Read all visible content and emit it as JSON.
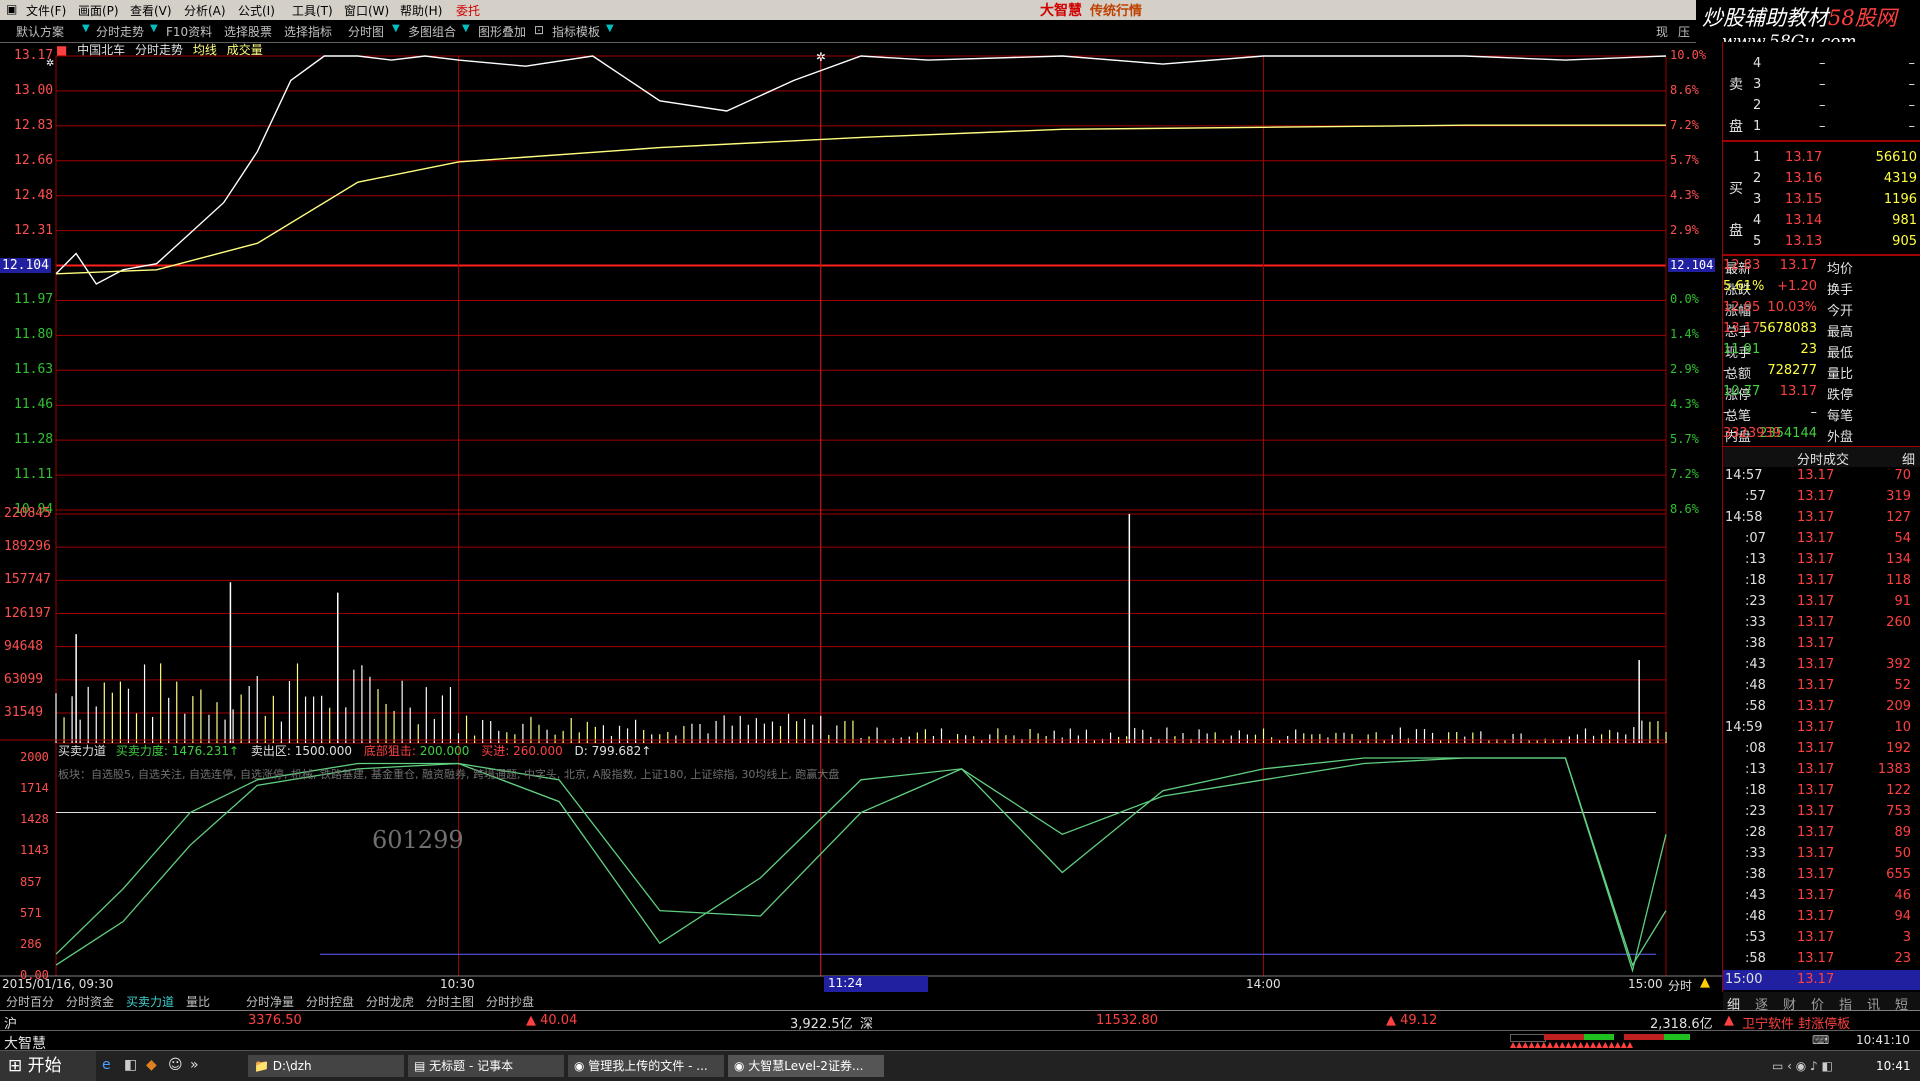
{
  "menu": {
    "items": [
      "文件(F)",
      "画面(P)",
      "查看(V)",
      "分析(A)",
      "公式(I)",
      "工具(T)",
      "窗口(W)",
      "帮助(H)",
      "委托"
    ],
    "brand": "大智慧",
    "brand_sub": "传统行情"
  },
  "watermark": {
    "line1_a": "炒股辅助教材",
    "line1_b": "58股网",
    "line2": "www.58Gu.com"
  },
  "toolbar": {
    "items": [
      "默认方案",
      "分时走势",
      "F10资料",
      "选择股票",
      "选择指标",
      "分时图",
      "多图组合",
      "图形叠加",
      "指标模板"
    ],
    "right": [
      "现",
      "压"
    ]
  },
  "legend": {
    "stock": "中国北车",
    "items": [
      "分时走势",
      "均线",
      "成交量"
    ]
  },
  "price_axis": {
    "labels": [
      "13.17",
      "13.00",
      "12.83",
      "12.66",
      "12.48",
      "12.31",
      "12.104",
      "11.97",
      "11.80",
      "11.63",
      "11.46",
      "11.28",
      "11.11",
      "10.94"
    ],
    "pct_labels": [
      "10.0%",
      "8.6%",
      "7.2%",
      "5.7%",
      "4.3%",
      "2.9%",
      "12.104",
      "0.0%",
      "1.4%",
      "2.9%",
      "4.3%",
      "5.7%",
      "7.2%",
      "8.6%"
    ]
  },
  "volume_axis": {
    "labels": [
      "220845",
      "189296",
      "157747",
      "126197",
      "94648",
      "63099",
      "31549"
    ]
  },
  "indicator": {
    "title": "买卖力道",
    "params": [
      {
        "k": "买卖力度",
        "v": "1476.231↑"
      },
      {
        "k": "卖出区",
        "v": "1500.000"
      },
      {
        "k": "底部狙击",
        "v": "200.000"
      },
      {
        "k": "买进",
        "v": "260.000"
      },
      {
        "k": "D",
        "v": "799.682↑"
      }
    ],
    "board_text": "板块：自选股5, 自选关注, 自选连停, 自选涨停, 机械, 铁路基建, 基金重仓, 融资融券, 跨境通题, 中字头, 北京, A股指数, 上证180, 上证综指, 30均线上, 跑赢大盘",
    "code_watermark": "601299",
    "labels": [
      "2000",
      "1714",
      "1428",
      "1143",
      "857",
      "571",
      "286",
      "0.00"
    ]
  },
  "time_axis": {
    "date_label": "2015/01/16, 09:30",
    "ticks": [
      "10:30",
      "11:24",
      "14:00",
      "15:00"
    ],
    "right": "分时"
  },
  "bottom_tabs": [
    "分时百分",
    "分时资金",
    "买卖力道",
    "量比",
    "分时净量",
    "分时控盘",
    "分时龙虎",
    "分时主图",
    "分时抄盘"
  ],
  "active_tab": "买卖力道",
  "index_bar": {
    "sh_label": "沪",
    "sh_value": "3376.50",
    "sh_change": "▲ 40.04",
    "sh_amount": "3,922.5亿",
    "sz_label": "深",
    "sz_value": "11532.80",
    "sz_change": "▲ 49.12",
    "sz_amount": "2,318.6亿",
    "notice": "卫宁软件 封涨停板"
  },
  "status": {
    "app": "大智慧",
    "time": "10:41:10"
  },
  "taskbar": {
    "start": "开始",
    "tasks": [
      "D:\\dzh",
      "无标题 - 记事本",
      "管理我上传的文件 - ...",
      "大智慧Level-2证券..."
    ],
    "clock": "10:41"
  },
  "order_book": {
    "sell_label": "卖盘",
    "buy_label": "买盘",
    "sells": [
      {
        "lvl": "4",
        "price": "–",
        "vol": "–"
      },
      {
        "lvl": "3",
        "price": "–",
        "vol": "–"
      },
      {
        "lvl": "2",
        "price": "–",
        "vol": "–"
      },
      {
        "lvl": "1",
        "price": "–",
        "vol": "–"
      }
    ],
    "buys": [
      {
        "lvl": "1",
        "price": "13.17",
        "vol": "56610"
      },
      {
        "lvl": "2",
        "price": "13.16",
        "vol": "4319"
      },
      {
        "lvl": "3",
        "price": "13.15",
        "vol": "1196"
      },
      {
        "lvl": "4",
        "price": "13.14",
        "vol": "981"
      },
      {
        "lvl": "5",
        "price": "13.13",
        "vol": "905"
      }
    ]
  },
  "quote": [
    {
      "k1": "最新",
      "v1": "13.17",
      "k2": "均价",
      "v2": "12.83"
    },
    {
      "k1": "涨跌",
      "v1": "+1.20",
      "k2": "换手",
      "v2": "5.61%"
    },
    {
      "k1": "涨幅",
      "v1": "10.03%",
      "k2": "今开",
      "v2": "12.05"
    },
    {
      "k1": "总手",
      "v1": "5678083",
      "k2": "最高",
      "v2": "13.17"
    },
    {
      "k1": "现手",
      "v1": "23",
      "k2": "最低",
      "v2": "11.91"
    },
    {
      "k1": "总额",
      "v1": "728277",
      "k2": "量比",
      "v2": "–"
    },
    {
      "k1": "涨停",
      "v1": "13.17",
      "k2": "跌停",
      "v2": "10.77"
    },
    {
      "k1": "总笔",
      "v1": "–",
      "k2": "每笔",
      "v2": "–"
    },
    {
      "k1": "内盘",
      "v1": "2354144",
      "k2": "外盘",
      "v2": "3323939"
    }
  ],
  "ticks_header": {
    "title": "分时成交",
    "right": "细"
  },
  "ticks": [
    {
      "t": "14:57",
      "p": "13.17",
      "v": "70"
    },
    {
      "t": ":57",
      "p": "13.17",
      "v": "319"
    },
    {
      "t": "14:58",
      "p": "13.17",
      "v": "127"
    },
    {
      "t": ":07",
      "p": "13.17",
      "v": "54"
    },
    {
      "t": ":13",
      "p": "13.17",
      "v": "134"
    },
    {
      "t": ":18",
      "p": "13.17",
      "v": "118"
    },
    {
      "t": ":23",
      "p": "13.17",
      "v": "91"
    },
    {
      "t": ":33",
      "p": "13.17",
      "v": "260"
    },
    {
      "t": ":38",
      "p": "13.17",
      "v": ""
    },
    {
      "t": ":43",
      "p": "13.17",
      "v": "392"
    },
    {
      "t": ":48",
      "p": "13.17",
      "v": "52"
    },
    {
      "t": ":58",
      "p": "13.17",
      "v": "209"
    },
    {
      "t": "14:59",
      "p": "13.17",
      "v": "10"
    },
    {
      "t": ":08",
      "p": "13.17",
      "v": "192"
    },
    {
      "t": ":13",
      "p": "13.17",
      "v": "1383"
    },
    {
      "t": ":18",
      "p": "13.17",
      "v": "122"
    },
    {
      "t": ":23",
      "p": "13.17",
      "v": "753"
    },
    {
      "t": ":28",
      "p": "13.17",
      "v": "89"
    },
    {
      "t": ":33",
      "p": "13.17",
      "v": "50"
    },
    {
      "t": ":38",
      "p": "13.17",
      "v": "655"
    },
    {
      "t": ":43",
      "p": "13.17",
      "v": "46"
    },
    {
      "t": ":48",
      "p": "13.17",
      "v": "94"
    },
    {
      "t": ":53",
      "p": "13.17",
      "v": "3"
    },
    {
      "t": ":58",
      "p": "13.17",
      "v": "23"
    },
    {
      "t": "15:00",
      "p": "13.17",
      "v": ""
    }
  ],
  "rp_tabs": [
    "细",
    "逐",
    "财",
    "价",
    "指",
    "讯",
    "短"
  ],
  "colors": {
    "up": "#ff4040",
    "down": "#40d040",
    "grid": "#a00000",
    "price_line": "#ffffff",
    "avg_line": "#ffff80",
    "ind_line": "#60d080"
  },
  "chart_data": {
    "type": "line",
    "title": "中国北车",
    "prev_close": 12.104,
    "ylim": [
      10.94,
      13.17
    ],
    "price_series": {
      "x": [
        "09:30",
        "09:33",
        "09:36",
        "09:40",
        "09:45",
        "09:50",
        "09:55",
        "10:00",
        "10:05",
        "10:10",
        "10:15",
        "10:20",
        "10:25",
        "10:30",
        "10:40",
        "10:50",
        "11:00",
        "11:10",
        "11:20",
        "11:30",
        "13:10",
        "13:30",
        "13:45",
        "14:00",
        "14:15",
        "14:30",
        "14:45",
        "15:00"
      ],
      "values": [
        12.1,
        12.2,
        12.05,
        12.12,
        12.15,
        12.3,
        12.45,
        12.7,
        13.05,
        13.17,
        13.17,
        13.15,
        13.17,
        13.15,
        13.12,
        13.17,
        12.95,
        12.9,
        13.05,
        13.17,
        13.15,
        13.17,
        13.13,
        13.17,
        13.17,
        13.17,
        13.15,
        13.17
      ]
    },
    "avg_series": {
      "x": [
        "09:30",
        "09:45",
        "10:00",
        "10:15",
        "10:30",
        "11:00",
        "11:30",
        "13:30",
        "14:00",
        "14:30",
        "15:00"
      ],
      "values": [
        12.1,
        12.12,
        12.25,
        12.55,
        12.65,
        12.72,
        12.77,
        12.81,
        12.82,
        12.83,
        12.83
      ]
    },
    "volume": {
      "ylim": [
        0,
        220845
      ],
      "highlights": [
        {
          "x": "09:33",
          "value": 105000
        },
        {
          "x": "09:56",
          "value": 155000
        },
        {
          "x": "10:12",
          "value": 145000
        },
        {
          "x": "13:40",
          "value": 220845
        },
        {
          "x": "14:56",
          "value": 80000
        }
      ]
    },
    "indicator_series": {
      "ylim": [
        0,
        2000
      ],
      "x": [
        "09:30",
        "09:40",
        "09:50",
        "10:00",
        "10:15",
        "10:30",
        "10:45",
        "11:00",
        "11:15",
        "11:30",
        "13:15",
        "13:30",
        "13:45",
        "14:00",
        "14:15",
        "14:30",
        "14:45",
        "14:55",
        "15:00"
      ],
      "k": [
        200,
        800,
        1500,
        1800,
        1950,
        1950,
        1600,
        300,
        900,
        1800,
        1900,
        950,
        1700,
        1900,
        2000,
        2000,
        2000,
        50,
        1300
      ],
      "d": [
        100,
        500,
        1200,
        1750,
        1900,
        1950,
        1800,
        600,
        550,
        1500,
        1900,
        1300,
        1650,
        1800,
        1950,
        2000,
        2000,
        100,
        600
      ]
    }
  }
}
